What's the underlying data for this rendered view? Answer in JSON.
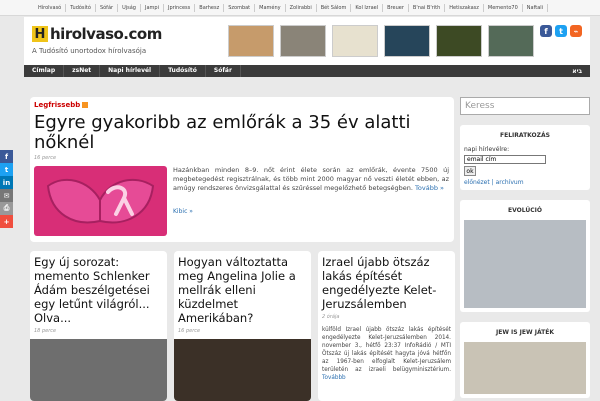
{
  "topbar": {
    "links": [
      "Hírolvasó",
      "Tudósító",
      "Sófár",
      "Ujság",
      "Jampi",
      "Jprincess",
      "Barhesz",
      "Szombat",
      "Mamény",
      "Zolirabbi",
      "Bét Sálom",
      "Kol Izrael",
      "Breuer",
      "B'nai B'rith",
      "Hetiszakasz",
      "Memento70",
      "Naftali"
    ]
  },
  "header": {
    "logo_letter": "H",
    "logo_text": "hirolvaso.com",
    "tagline": "A Tudósító unortodox hírolvasója"
  },
  "nav": {
    "items": [
      "Címlap",
      "zsNet",
      "Napi hírlevél",
      "Tudósító",
      "Sófár"
    ],
    "right": "ביא"
  },
  "feature": {
    "label": "Legfrissebb",
    "title": "Egyre gyakoribb az emlőrák a 35 év alatti nőknél",
    "time": "16 perce",
    "text": "Hazánkban minden 8–9. nőt érint élete során az emlőrák, évente 7500 új megbetegedést regisztrálnak, és több mint 2000 magyar nő veszti életét ebben, az amúgy rendszeres önvizsgálattal és szűréssel megelőzhető betegségben.",
    "link": "Tovább »",
    "more": "Kibic »"
  },
  "cards": [
    {
      "title": "Egy új sorozat: memento Schlenker Ádám beszélgetései egy letűnt világról... Olva...",
      "time": "18 perce",
      "text": ""
    },
    {
      "title": "Hogyan változtatta meg Angelina Jolie a mellrák elleni küzdelmet Amerikában?",
      "time": "16 perce",
      "text": ""
    },
    {
      "title": "Izrael újabb ötszáz lakás építését engedélyezte Kelet-Jeruzsálemben",
      "time": "2 órája",
      "text": "külföld Izrael újabb ötszáz lakás építését engedélyezte Kelet-Jeruzsálemben 2014. november 3., hétfő 23:37 InfoRádió / MTI Ötszáz új lakás építését hagyta jóvá hétfőn az 1967-ben elfoglalt Kelet-Jeruzsálem területén az izraeli belügyminisztérium.",
      "link": "Továbbb"
    }
  ],
  "sidebar": {
    "search_placeholder": "Keress",
    "feliratkozas_title": "FELIRATKOZÁS",
    "napi_label": "napi hírlevélre:",
    "email_placeholder": "email cím",
    "ok_label": "ok",
    "archive_links": [
      "előnézet",
      "archívum"
    ],
    "evolucio_title": "EVOLÚCIÓ",
    "jew_title": "JEW IS JEW JÁTÉK"
  },
  "share": [
    "f",
    "t",
    "in",
    "✉",
    "⎙",
    "+"
  ],
  "colors": {
    "accent": "#c00000",
    "link": "#2a6fb0",
    "nav_bg": "#3b3b3b",
    "logo_yellow": "#f0c419"
  }
}
